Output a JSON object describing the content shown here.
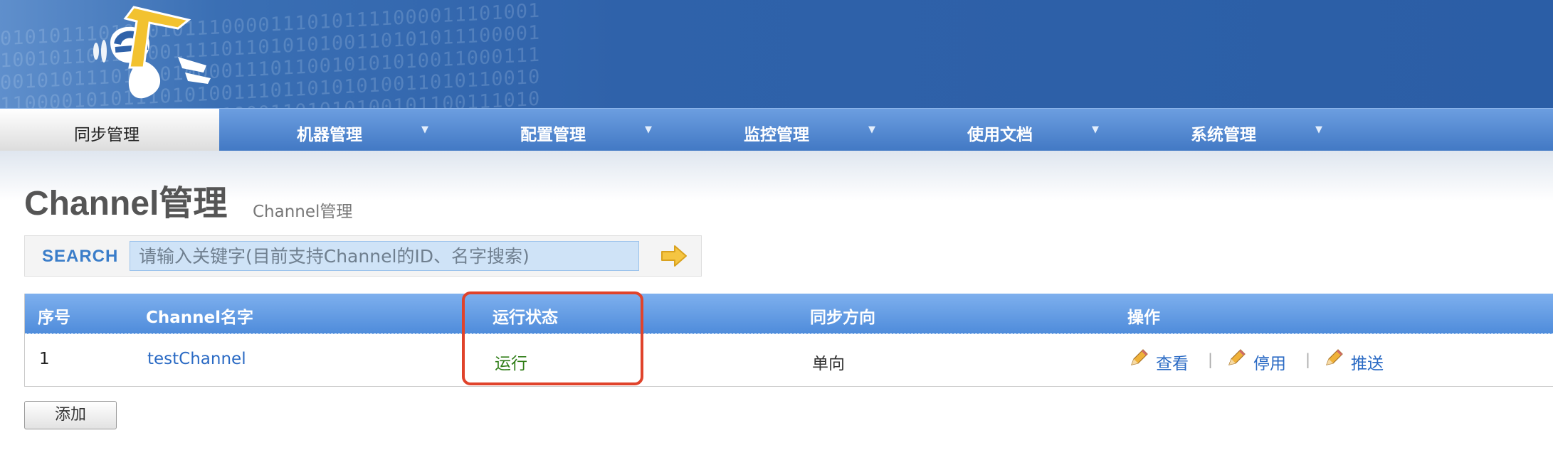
{
  "nav": {
    "items": [
      {
        "label": "同步管理",
        "active": true
      },
      {
        "label": "机器管理",
        "active": false
      },
      {
        "label": "配置管理",
        "active": false
      },
      {
        "label": "监控管理",
        "active": false
      },
      {
        "label": "使用文档",
        "active": false
      },
      {
        "label": "系统管理",
        "active": false
      }
    ]
  },
  "page": {
    "title": "Channel管理",
    "subtitle": "Channel管理"
  },
  "search": {
    "label": "SEARCH",
    "placeholder": "请输入关键字(目前支持Channel的ID、名字搜索)"
  },
  "table": {
    "headers": [
      "序号",
      "Channel名字",
      "运行状态",
      "同步方向",
      "操作"
    ],
    "rows": [
      {
        "index": "1",
        "name": "testChannel",
        "status": "运行",
        "direction": "单向",
        "actions": [
          "查看",
          "停用",
          "推送"
        ]
      }
    ]
  },
  "footer": {
    "add_label": "添加"
  },
  "colors": {
    "nav_blue": "#4f8cdb",
    "status_running": "#2f7d16",
    "link": "#2a6ac4",
    "highlight": "#e0432b"
  },
  "icons": [
    "logo-otter",
    "arrow-right-icon",
    "pencil-icon",
    "caret-down-icon"
  ]
}
